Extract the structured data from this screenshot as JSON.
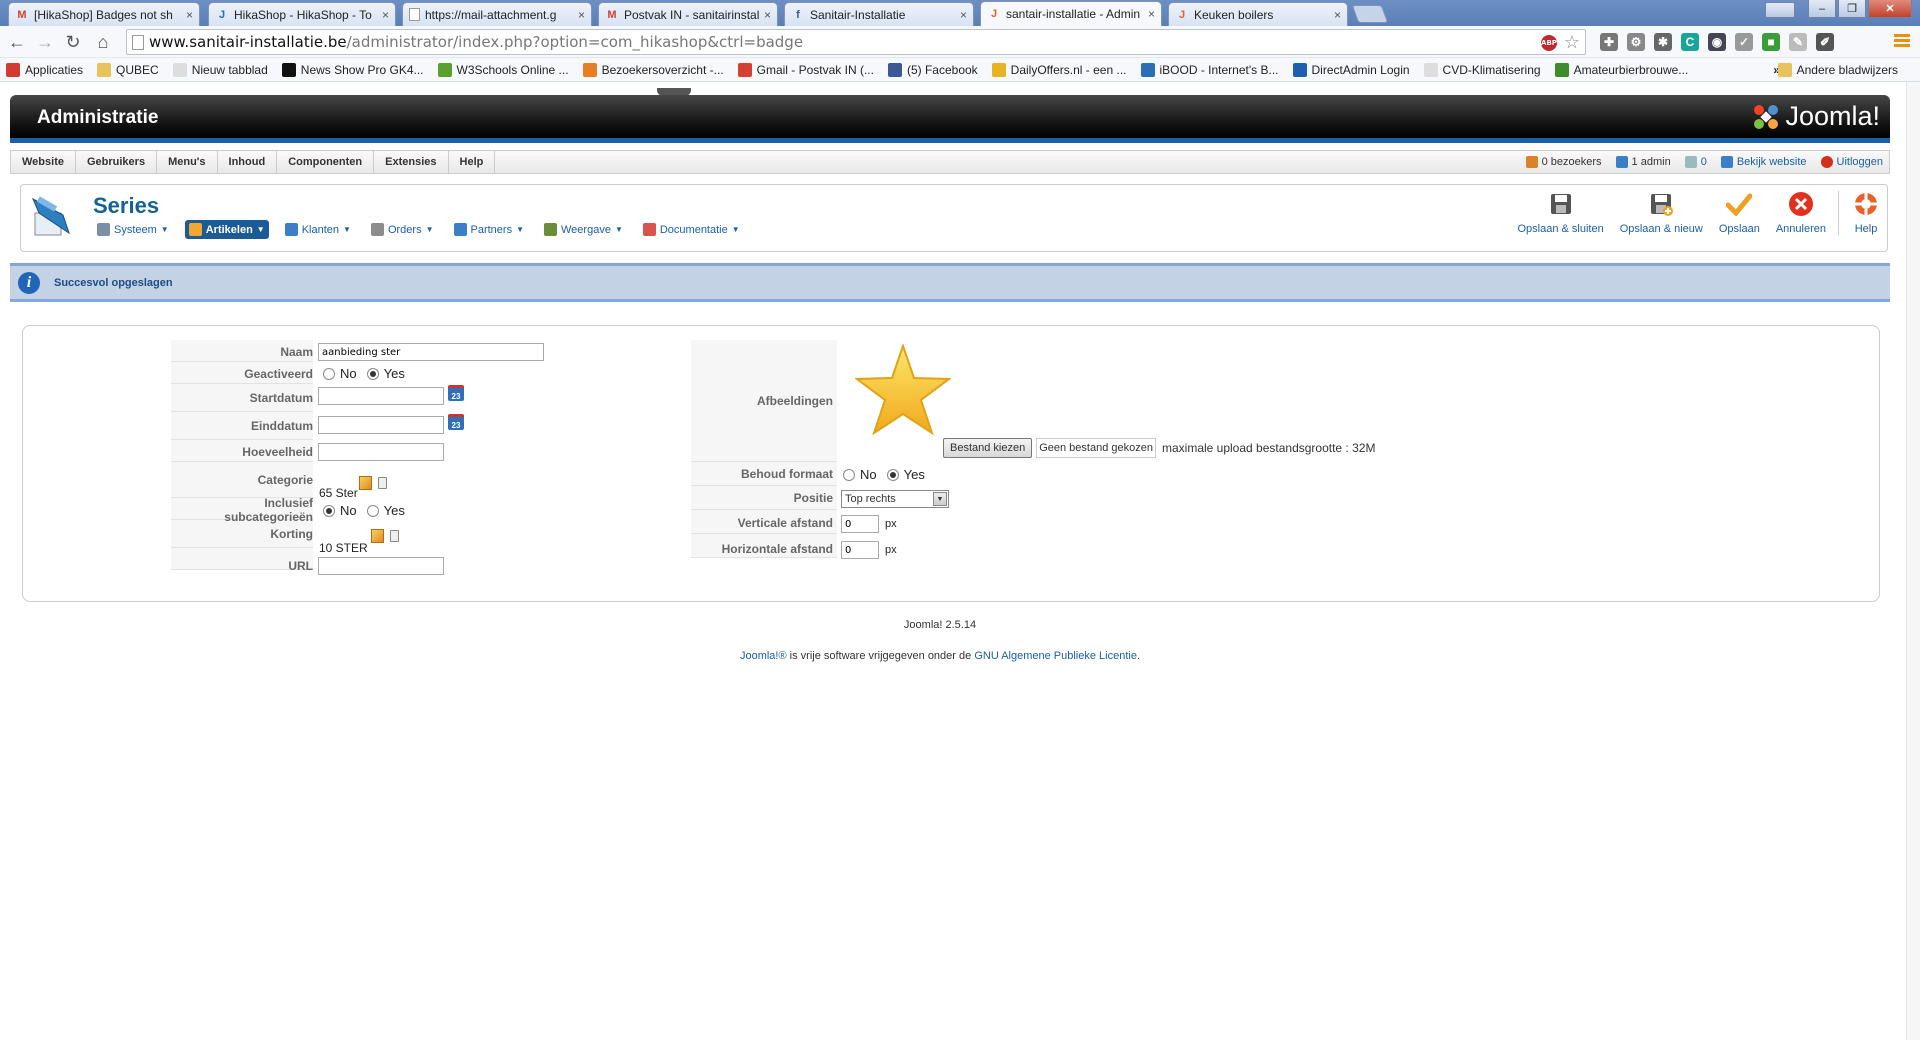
{
  "browser": {
    "tabs": [
      {
        "label": "[HikaShop] Badges not sh",
        "fav": "M",
        "color": "#d44132"
      },
      {
        "label": "HikaShop - HikaShop - To",
        "fav": "J",
        "color": "#1b75bc"
      },
      {
        "label": "https://mail-attachment.g",
        "fav": "",
        "color": "#888888"
      },
      {
        "label": "Postvak IN - sanitairinstall",
        "fav": "M",
        "color": "#d44132"
      },
      {
        "label": "Sanitair-Installatie",
        "fav": "f",
        "color": "#3b5998"
      },
      {
        "label": "santair-installatie - Admin",
        "fav": "J",
        "color": "#e8622c"
      },
      {
        "label": "Keuken boilers",
        "fav": "J",
        "color": "#e8622c"
      }
    ],
    "active_tab_index": 5,
    "url_domain": "www.sanitair-installatie.be",
    "url_path": "/administrator/index.php?option=com_hikashop&ctrl=badge",
    "bookmarks": [
      {
        "label": "Applicaties",
        "icon": "apps-icon",
        "color": "#d23c2f"
      },
      {
        "label": "QUBEC",
        "icon": "folder-icon",
        "color": "#e8c25a"
      },
      {
        "label": "Nieuw tabblad",
        "icon": "page-icon",
        "color": "#dddddd"
      },
      {
        "label": "News Show Pro GK4...",
        "icon": "gk-icon",
        "color": "#111111"
      },
      {
        "label": "W3Schools Online ...",
        "icon": "w3-icon",
        "color": "#5aa02c"
      },
      {
        "label": "Bezoekersoverzicht -...",
        "icon": "chart-icon",
        "color": "#e67e22"
      },
      {
        "label": "Gmail - Postvak IN (...",
        "icon": "gmail-icon",
        "color": "#d44132"
      },
      {
        "label": "(5) Facebook",
        "icon": "facebook-icon",
        "color": "#3b5998"
      },
      {
        "label": "DailyOffers.nl - een ...",
        "icon": "euro-icon",
        "color": "#e6b422"
      },
      {
        "label": "iBOOD - Internet's B...",
        "icon": "ibood-icon",
        "color": "#2a6fb6"
      },
      {
        "label": "DirectAdmin Login",
        "icon": "directadmin-icon",
        "color": "#1d5fb0"
      },
      {
        "label": "CVD-Klimatisering",
        "icon": "page-icon",
        "color": "#dddddd"
      },
      {
        "label": "Amateurbierbrouwe...",
        "icon": "beer-icon",
        "color": "#3f8c2c"
      }
    ],
    "bookmarks_more": "»",
    "other_bookmarks": "Andere bladwijzers"
  },
  "admin": {
    "header_title": "Administratie",
    "logo_text": "Joomla!",
    "menu": [
      "Website",
      "Gebruikers",
      "Menu's",
      "Inhoud",
      "Componenten",
      "Extensies",
      "Help"
    ],
    "status": {
      "visitors": "0 bezoekers",
      "admins": "1 admin",
      "messages": "0",
      "view_site": "Bekijk website",
      "logout": "Uitloggen"
    },
    "page_title": "Series",
    "submenu": [
      {
        "label": "Systeem",
        "active": false,
        "color": "#7b8fa6"
      },
      {
        "label": "Artikelen",
        "active": true,
        "color": "#f0a830"
      },
      {
        "label": "Klanten",
        "active": false,
        "color": "#3a7fc8"
      },
      {
        "label": "Orders",
        "active": false,
        "color": "#8c8c8c"
      },
      {
        "label": "Partners",
        "active": false,
        "color": "#3a7fc8"
      },
      {
        "label": "Weergave",
        "active": false,
        "color": "#6b8e3a"
      },
      {
        "label": "Documentatie",
        "active": false,
        "color": "#d9534f"
      }
    ],
    "toolbar": {
      "save_close": "Opslaan & sluiten",
      "save_new": "Opslaan & nieuw",
      "save": "Opslaan",
      "cancel": "Annuleren",
      "help": "Help"
    },
    "message": "Succesvol opgeslagen"
  },
  "form": {
    "labels": {
      "name": "Naam",
      "activated": "Geactiveerd",
      "start": "Startdatum",
      "end": "Einddatum",
      "quantity": "Hoeveelheid",
      "category": "Categorie",
      "subcat": "Inclusief subcategorieën",
      "discount": "Korting",
      "url": "URL",
      "images": "Afbeeldingen",
      "keep_format": "Behoud formaat",
      "position": "Positie",
      "vertical": "Verticale afstand",
      "horizontal": "Horizontale afstand"
    },
    "values": {
      "name": "aanbieding ster",
      "activated": "Yes",
      "start": "",
      "end": "",
      "quantity": "",
      "category": "65 Ster",
      "subcat": "No",
      "discount": "10 STER",
      "url": "",
      "keep_format": "Yes",
      "position": "Top rechts",
      "vertical": "0",
      "horizontal": "0"
    },
    "radio": {
      "no": "No",
      "yes": "Yes"
    },
    "calendar_day": "23",
    "file_button": "Bestand kiezen",
    "file_none": "Geen bestand gekozen",
    "upload_max": "maximale upload bestandsgrootte : 32M",
    "px": "px"
  },
  "footer": {
    "version": "Joomla! 2.5.14",
    "license_link1": "Joomla!®",
    "license_text": " is vrije software vrijgegeven onder de ",
    "license_link2": "GNU Algemene Publieke Licentie",
    "license_end": "."
  }
}
